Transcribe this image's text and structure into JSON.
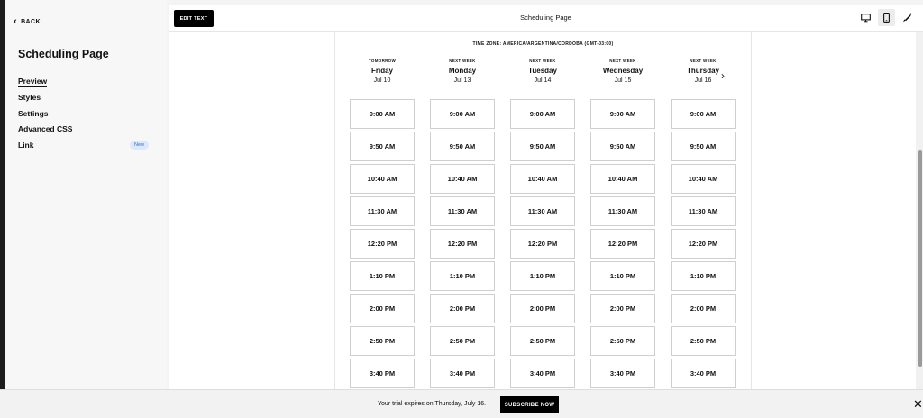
{
  "sidebar": {
    "back_label": "BACK",
    "title": "Scheduling Page",
    "items": [
      {
        "label": "Preview",
        "active": true
      },
      {
        "label": "Styles"
      },
      {
        "label": "Settings"
      },
      {
        "label": "Advanced CSS"
      },
      {
        "label": "Link",
        "badge": "New"
      }
    ]
  },
  "topbar": {
    "edit_label": "EDIT TEXT",
    "title": "Scheduling Page",
    "devices": [
      "desktop-icon",
      "mobile-icon",
      "brush-icon"
    ]
  },
  "schedule": {
    "timezone": "TIME ZONE: AMERICA/ARGENTINA/CORDOBA (GMT-03:00)",
    "days": [
      {
        "relative": "TOMORROW",
        "name": "Friday",
        "date": "Jul 10"
      },
      {
        "relative": "NEXT WEEK",
        "name": "Monday",
        "date": "Jul 13"
      },
      {
        "relative": "NEXT WEEK",
        "name": "Tuesday",
        "date": "Jul 14"
      },
      {
        "relative": "NEXT WEEK",
        "name": "Wednesday",
        "date": "Jul 15"
      },
      {
        "relative": "NEXT WEEK",
        "name": "Thursday",
        "date": "Jul 16"
      }
    ],
    "times": [
      "9:00 AM",
      "9:50 AM",
      "10:40 AM",
      "11:30 AM",
      "12:20 PM",
      "1:10 PM",
      "2:00 PM",
      "2:50 PM",
      "3:40 PM"
    ]
  },
  "trial": {
    "text": "Your trial expires on Thursday, July 16.",
    "button": "SUBSCRIBE NOW"
  },
  "colors": {
    "accent": "#000000",
    "badge_bg": "#dce9fb",
    "badge_text": "#3b6cc9"
  }
}
